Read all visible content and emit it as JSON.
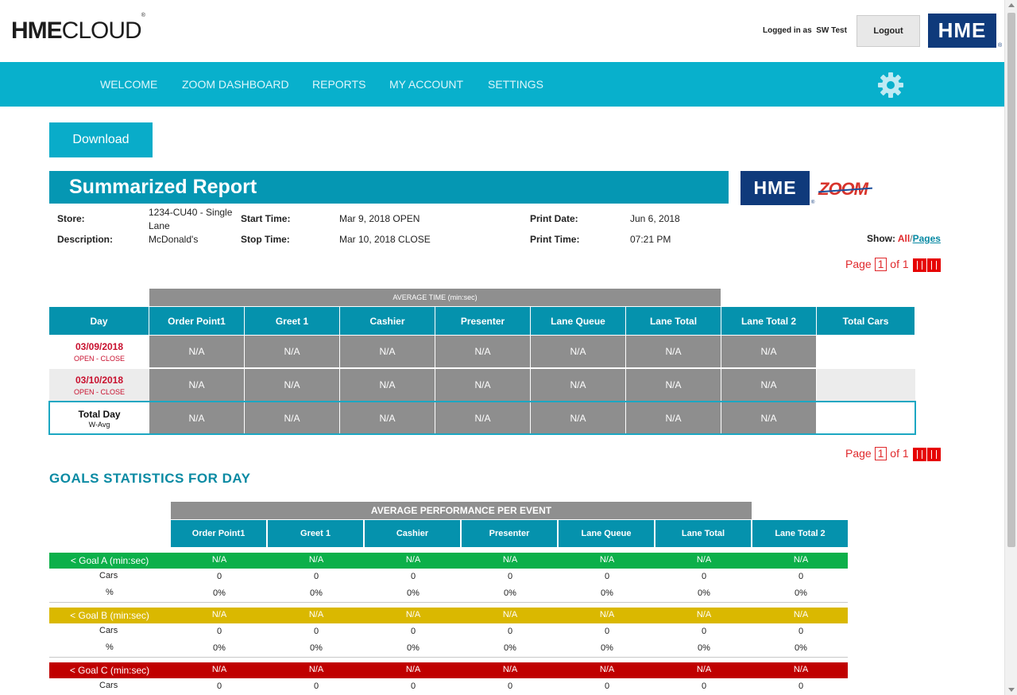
{
  "header": {
    "logo_bold": "HME",
    "logo_light": "CLOUD",
    "logo_mark": "®",
    "logged_in_label": "Logged in as",
    "user": "SW Test",
    "logout_label": "Logout",
    "brand_badge": "HME",
    "brand_mark": "®"
  },
  "nav": {
    "items": [
      "WELCOME",
      "ZOOM DASHBOARD",
      "REPORTS",
      "MY ACCOUNT",
      "SETTINGS"
    ],
    "settings_icon": "gear-icon"
  },
  "download_label": "Download",
  "report": {
    "title": "Summarized Report",
    "brand_badge": "HME",
    "brand_mark": "®",
    "zoom_logo": "ZOOM",
    "store_label": "Store:",
    "store_value_line1": "1234-CU40 - Single",
    "store_value_line2": "Lane",
    "description_label": "Description:",
    "description_value": "McDonald's",
    "start_label": "Start Time:",
    "start_value": "Mar 9, 2018 OPEN",
    "stop_label": "Stop Time:",
    "stop_value": "Mar 10, 2018 CLOSE",
    "print_date_label": "Print Date:",
    "print_date_value": "Jun 6, 2018",
    "print_time_label": "Print Time:",
    "print_time_value": "07:21 PM",
    "show_label": "Show:",
    "show_all": "All",
    "show_sep": "/",
    "show_pages": "Pages",
    "pager": {
      "page_label": "Page",
      "current": "1",
      "of_label": "of",
      "total": "1"
    }
  },
  "summary_table": {
    "group_header": "AVERAGE TIME (min:sec)",
    "columns": [
      "Day",
      "Order Point1",
      "Greet 1",
      "Cashier",
      "Presenter",
      "Lane Queue",
      "Lane Total",
      "Lane Total 2",
      "Total Cars"
    ],
    "rows": [
      {
        "day": "03/09/2018",
        "sub": "OPEN - CLOSE",
        "values": [
          "N/A",
          "N/A",
          "N/A",
          "N/A",
          "N/A",
          "N/A",
          "N/A"
        ],
        "total_cars": ""
      },
      {
        "day": "03/10/2018",
        "sub": "OPEN - CLOSE",
        "values": [
          "N/A",
          "N/A",
          "N/A",
          "N/A",
          "N/A",
          "N/A",
          "N/A"
        ],
        "total_cars": ""
      }
    ],
    "total_row": {
      "day": "Total Day",
      "sub": "W-Avg",
      "values": [
        "N/A",
        "N/A",
        "N/A",
        "N/A",
        "N/A",
        "N/A",
        "N/A"
      ],
      "total_cars": ""
    }
  },
  "goals": {
    "title": "GOALS STATISTICS FOR DAY",
    "group_header": "AVERAGE PERFORMANCE PER EVENT",
    "columns": [
      "Order Point1",
      "Greet 1",
      "Cashier",
      "Presenter",
      "Lane Queue",
      "Lane Total",
      "Lane Total 2"
    ],
    "sections": [
      {
        "label": "< Goal A (min:sec)",
        "color": "#0cb04a",
        "values": [
          "N/A",
          "N/A",
          "N/A",
          "N/A",
          "N/A",
          "N/A",
          "N/A"
        ],
        "cars_label": "Cars",
        "cars": [
          "0",
          "0",
          "0",
          "0",
          "0",
          "0",
          "0"
        ],
        "pct_label": "%",
        "pct": [
          "0%",
          "0%",
          "0%",
          "0%",
          "0%",
          "0%",
          "0%"
        ]
      },
      {
        "label": "< Goal B (min:sec)",
        "color": "#dab800",
        "values": [
          "N/A",
          "N/A",
          "N/A",
          "N/A",
          "N/A",
          "N/A",
          "N/A"
        ],
        "cars_label": "Cars",
        "cars": [
          "0",
          "0",
          "0",
          "0",
          "0",
          "0",
          "0"
        ],
        "pct_label": "%",
        "pct": [
          "0%",
          "0%",
          "0%",
          "0%",
          "0%",
          "0%",
          "0%"
        ]
      },
      {
        "label": "< Goal C (min:sec)",
        "color": "#c00000",
        "values": [
          "N/A",
          "N/A",
          "N/A",
          "N/A",
          "N/A",
          "N/A",
          "N/A"
        ],
        "cars_label": "Cars",
        "cars": [
          "0",
          "0",
          "0",
          "0",
          "0",
          "0",
          "0"
        ]
      }
    ]
  }
}
